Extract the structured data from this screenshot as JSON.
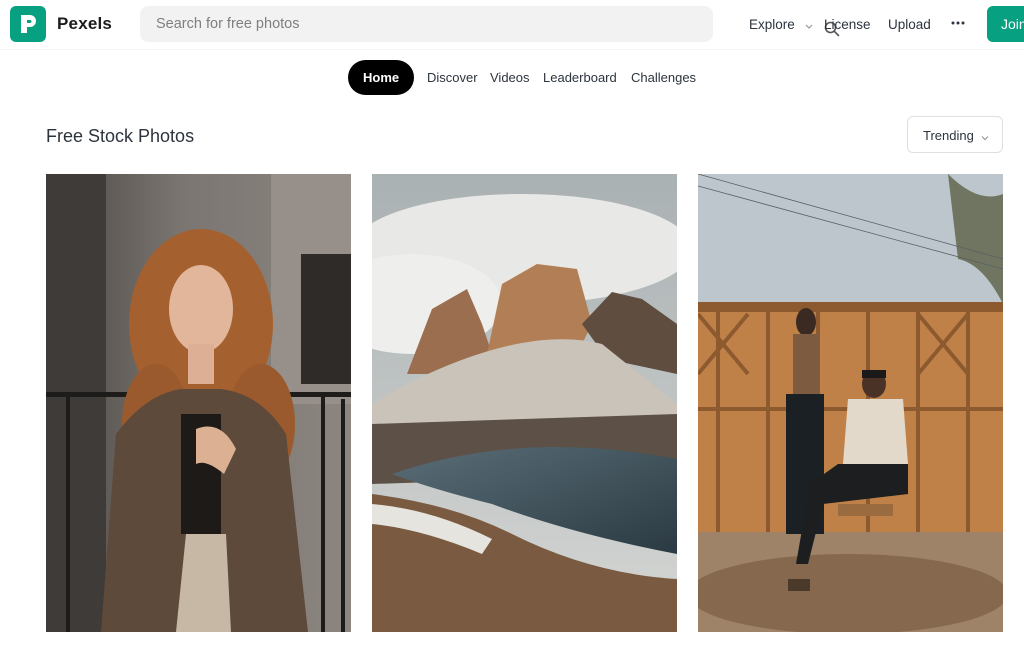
{
  "header": {
    "brand": "Pexels",
    "search_placeholder": "Search for free photos",
    "nav": {
      "explore": "Explore",
      "license": "License",
      "upload": "Upload",
      "more": "···",
      "join": "Join"
    }
  },
  "tabs": [
    "Home",
    "Discover",
    "Videos",
    "Leaderboard",
    "Challenges"
  ],
  "active_tab": "Home",
  "main": {
    "title": "Free Stock Photos",
    "sort_value": "Trending"
  },
  "photos": [
    {
      "subject": "woman with curly red hair in plaid blazer"
    },
    {
      "subject": "misty mountain peaks above a lake"
    },
    {
      "subject": "two people in front of wooden gate"
    }
  ],
  "colors": {
    "accent": "#07a081",
    "text": "#2c343e",
    "active_tab_bg": "#000000"
  }
}
